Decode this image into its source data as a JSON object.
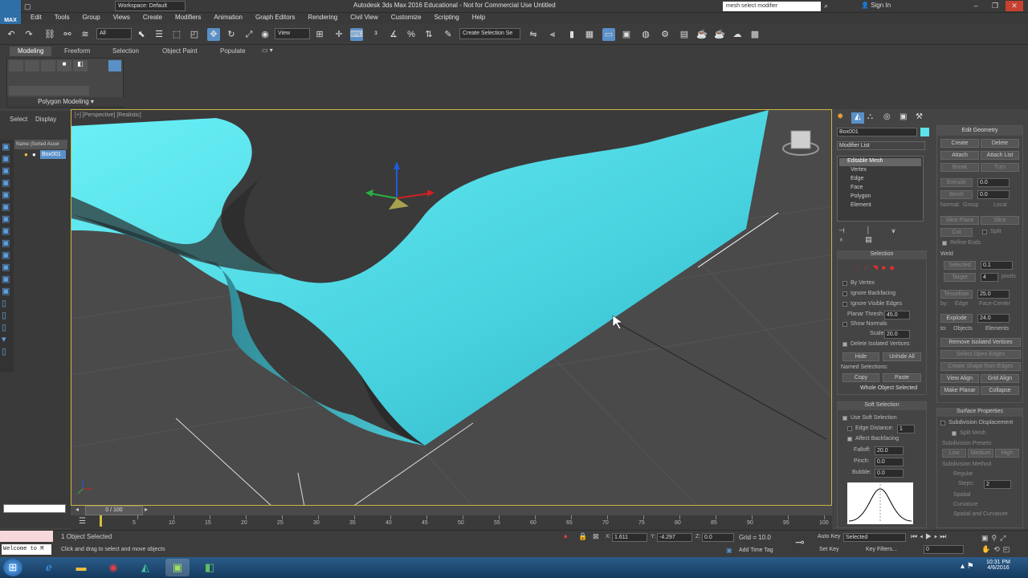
{
  "app": {
    "logo_label": "MAX",
    "workspace": "Workspace: Default",
    "title": "Autodesk 3ds Max 2016 Educational - Not for Commercial Use   Untitled",
    "search_value": "mesh select modifier",
    "sign_in": "Sign In"
  },
  "menu": [
    "Edit",
    "Tools",
    "Group",
    "Views",
    "Create",
    "Modifiers",
    "Animation",
    "Graph Editors",
    "Rendering",
    "Civil View",
    "Customize",
    "Scripting",
    "Help"
  ],
  "toolbar": {
    "filter_value": "All",
    "coord_value": "View",
    "selset_value": "Create Selection Se"
  },
  "ribbon": {
    "tabs": [
      "Modeling",
      "Freeform",
      "Selection",
      "Object Paint",
      "Populate"
    ],
    "panel_label": "Polygon Modeling"
  },
  "scene": {
    "tabs": [
      "Select",
      "Display"
    ],
    "header": "Name (Sorted Ascer",
    "item": "Box001"
  },
  "viewport": {
    "label": "[+] [Perspective] [Realistic]"
  },
  "command_panel": {
    "object_name": "Box001",
    "modifier_list": "Modifier List",
    "stack": [
      "Editable Mesh",
      "Vertex",
      "Edge",
      "Face",
      "Polygon",
      "Element"
    ],
    "selection": {
      "title": "Selection",
      "by_vertex": "By Vertex",
      "ignore_backfacing": "Ignore Backfacing",
      "ignore_visible_edges": "Ignore Visible Edges",
      "planar_thresh": "Planar Thresh:",
      "planar_value": "45.0",
      "show_normals": "Show Normals",
      "scale": "Scale:",
      "scale_value": "20.0",
      "delete_isolated": "Delete Isolated Vertices",
      "hide": "Hide",
      "unhide_all": "Unhide All",
      "named_selections": "Named Selections:",
      "copy": "Copy",
      "paste": "Paste",
      "whole_object": "Whole Object Selected"
    },
    "soft_selection": {
      "title": "Soft Selection",
      "use_soft": "Use Soft Selection",
      "edge_distance": "Edge Distance:",
      "edge_value": "1",
      "affect_backfacing": "Affect Backfacing",
      "falloff": "Falloff:",
      "falloff_value": "20.0",
      "pinch": "Pinch:",
      "pinch_value": "0.0",
      "bubble": "Bubble:",
      "bubble_value": "0.0"
    },
    "edit_geometry": {
      "title": "Edit Geometry",
      "create": "Create",
      "delete": "Delete",
      "attach": "Attach",
      "attach_list": "Attach List",
      "break": "Break",
      "turn": "Turn",
      "extrude": "Extrude",
      "extrude_value": "0.0",
      "bevel": "Bevel",
      "bevel_value": "0.0",
      "normal": "Normal:",
      "group": "Group",
      "local": "Local",
      "slice_plane": "Slice Plane",
      "slice": "Slice",
      "cut": "Cut",
      "split": "Split",
      "refine_ends": "Refine Ends",
      "weld": "Weld",
      "selected": "Selected",
      "selected_value": "0.1",
      "target": "Target",
      "target_value": "4",
      "pixels": "pixels",
      "tessellate": "Tessellate",
      "tessellate_value": "25.0",
      "by": "by:",
      "edge": "Edge",
      "face_center": "Face-Center",
      "explode": "Explode",
      "explode_value": "24.0",
      "to": "to:",
      "objects": "Objects",
      "elements": "Elements",
      "remove_isolated": "Remove Isolated Vertices",
      "select_open_edges": "Select Open Edges",
      "create_shape": "Create Shape from Edges",
      "view_align": "View Align",
      "grid_align": "Grid Align",
      "make_planar": "Make Planar",
      "collapse": "Collapse"
    },
    "surface": {
      "title": "Surface Properties",
      "subdivision_displacement": "Subdivision Displacement",
      "split_mesh": "Split Mesh",
      "presets": "Subdivision Presets",
      "low": "Low",
      "medium": "Medium",
      "high": "High",
      "method": "Subdivision Method",
      "regular": "Regular",
      "steps": "Steps:",
      "steps_value": "2",
      "spatial": "Spatial",
      "curvature": "Curvature",
      "spatial_curvature": "Spatial and Curvature"
    }
  },
  "timeline": {
    "frame": "0 / 100",
    "ticks": [
      "5",
      "10",
      "15",
      "20",
      "25",
      "30",
      "35",
      "40",
      "45",
      "50",
      "55",
      "60",
      "65",
      "70",
      "75",
      "80",
      "85",
      "90",
      "95",
      "100"
    ]
  },
  "status": {
    "selected": "1 Object Selected",
    "prompt": "Click and drag to select and move objects",
    "x_label": "X:",
    "x_value": "1.611",
    "y_label": "Y:",
    "y_value": "-4.297",
    "z_label": "Z:",
    "z_value": "0.0",
    "grid": "Grid = 10.0",
    "add_time_tag": "Add Time Tag",
    "auto_key": "Auto Key",
    "set_key": "Set Key",
    "key_mode": "Selected",
    "key_filters": "Key Filters...",
    "frame_value": "0",
    "welcome": "Welcome to M"
  },
  "taskbar": {
    "time": "10:31 PM",
    "date": "4/6/2016"
  },
  "colors": {
    "accent": "#5a90c8",
    "mesh": "#5ee1ea",
    "viewport_border": "#c9b642"
  }
}
